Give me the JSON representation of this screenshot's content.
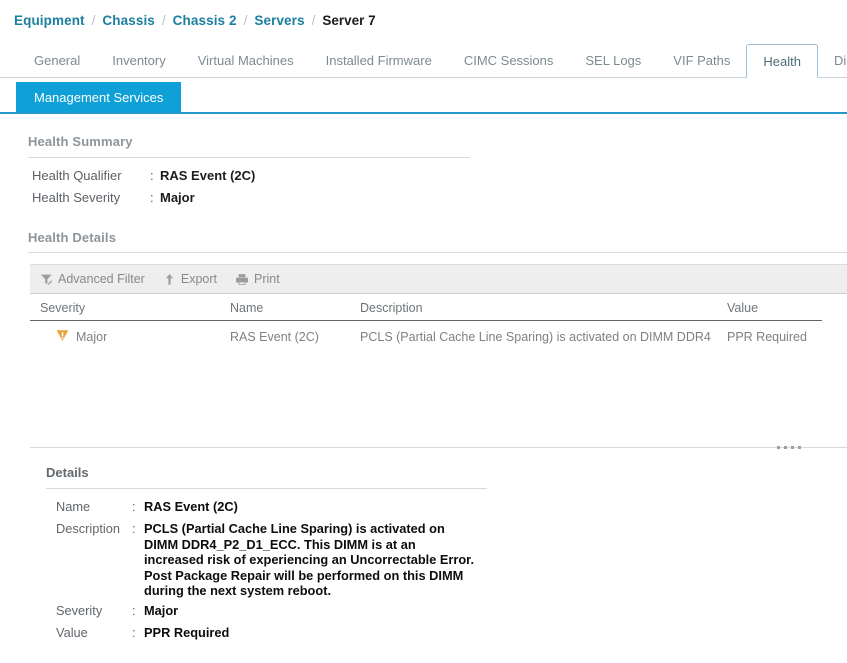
{
  "breadcrumb": {
    "separator": "/",
    "items": [
      {
        "label": "Equipment",
        "current": false
      },
      {
        "label": "Chassis",
        "current": false
      },
      {
        "label": "Chassis 2",
        "current": false
      },
      {
        "label": "Servers",
        "current": false
      },
      {
        "label": "Server 7",
        "current": true
      }
    ]
  },
  "tabs": {
    "active": "Health",
    "items": [
      {
        "label": "General"
      },
      {
        "label": "Inventory"
      },
      {
        "label": "Virtual Machines"
      },
      {
        "label": "Installed Firmware"
      },
      {
        "label": "CIMC Sessions"
      },
      {
        "label": "SEL Logs"
      },
      {
        "label": "VIF Paths"
      },
      {
        "label": "Health"
      },
      {
        "label": "Diagnostics"
      }
    ]
  },
  "subtabs": {
    "active": "Management Services",
    "items": [
      {
        "label": "Management Services"
      }
    ]
  },
  "health_summary": {
    "title": "Health Summary",
    "rows": [
      {
        "label": "Health Qualifier",
        "colon": ":",
        "value": "RAS Event (2C)"
      },
      {
        "label": "Health Severity",
        "colon": ":",
        "value": "Major"
      }
    ]
  },
  "health_details": {
    "title": "Health Details",
    "toolbar": {
      "advanced_filter": "Advanced Filter",
      "export": "Export",
      "print": "Print"
    },
    "table": {
      "columns": [
        "Severity",
        "Name",
        "Description",
        "Value"
      ],
      "rows": [
        {
          "severity": "Major",
          "severity_icon": "major-warning-icon",
          "name": "RAS Event (2C)",
          "description": "PCLS (Partial Cache Line Sparing) is activated on DIMM DDR4",
          "value": "PPR Required"
        }
      ]
    }
  },
  "details": {
    "title": "Details",
    "rows": [
      {
        "label": "Name",
        "colon": ":",
        "value": "RAS Event (2C)"
      },
      {
        "label": "Description",
        "colon": ":",
        "value": "PCLS (Partial Cache Line Sparing) is activated on DIMM DDR4_P2_D1_ECC. This DIMM is at an increased risk of experiencing an Uncorrectable Error. Post Package Repair will be performed on this DIMM during the next system reboot."
      },
      {
        "label": "Severity",
        "colon": ":",
        "value": "Major"
      },
      {
        "label": "Value",
        "colon": ":",
        "value": "PPR Required"
      }
    ]
  },
  "colors": {
    "link": "#1b7fa0",
    "accent_blue": "#0fa0d8",
    "accent_underline": "#2398cd",
    "severity_major": "#e8a33d",
    "toolbar_bg": "#eeeeee",
    "muted_text": "#8d959a"
  }
}
